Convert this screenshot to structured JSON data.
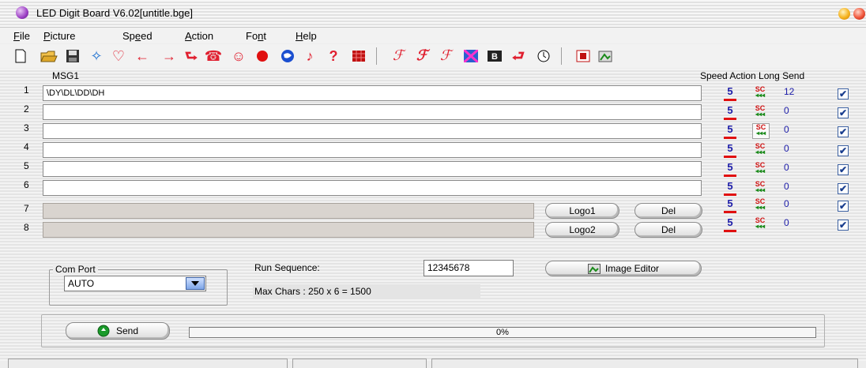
{
  "window": {
    "title": "LED Digit Board V6.02[untitle.bge]"
  },
  "menu": {
    "file": {
      "hot": "F",
      "rest": "ile"
    },
    "picture": {
      "hot": "P",
      "rest": "icture"
    },
    "speed": {
      "pre": "Sp",
      "hot": "e",
      "rest": "ed"
    },
    "action": {
      "hot": "A",
      "rest": "ction"
    },
    "font": {
      "pre": "Fo",
      "hot": "n",
      "rest": "t"
    },
    "help": {
      "hot": "H",
      "rest": "elp"
    }
  },
  "toolbar": {
    "icons": [
      "new-file-icon",
      "open-folder-icon",
      "save-disk-icon",
      "move-arrows-icon",
      "heart-icon",
      "arrow-left-icon",
      "arrow-right-icon",
      "enter-icon",
      "phone-icon",
      "smiley-icon",
      "red-circle-icon",
      "globe-icon",
      "music-note-icon",
      "question-icon",
      "grid-icon",
      "font-script-1-icon",
      "font-script-2-icon",
      "font-script-3-icon",
      "pattern-icon",
      "bold-icon",
      "reverse-icon",
      "clock-icon",
      "screen-icon",
      "image-editor-icon"
    ]
  },
  "messages": {
    "header": "MSG1",
    "column_headers": "Speed Action Long Send",
    "rows": [
      {
        "num": "1",
        "text": "\\DY\\DL\\DD\\DH",
        "speed": "5",
        "action": "SC",
        "long": "12",
        "send": "✔"
      },
      {
        "num": "2",
        "text": "",
        "speed": "5",
        "action": "SC",
        "long": "0",
        "send": "✔"
      },
      {
        "num": "3",
        "text": "",
        "speed": "5",
        "action": "SC",
        "long": "0",
        "send": "✔"
      },
      {
        "num": "4",
        "text": "",
        "speed": "5",
        "action": "SC",
        "long": "0",
        "send": "✔"
      },
      {
        "num": "5",
        "text": "",
        "speed": "5",
        "action": "SC",
        "long": "0",
        "send": "✔"
      },
      {
        "num": "6",
        "text": "",
        "speed": "5",
        "action": "SC",
        "long": "0",
        "send": "✔"
      },
      {
        "num": "7",
        "text": "",
        "speed": "5",
        "action": "SC",
        "long": "0",
        "send": "✔"
      },
      {
        "num": "8",
        "text": "",
        "speed": "5",
        "action": "SC",
        "long": "0",
        "send": "✔"
      }
    ],
    "action_arrows": "◂◂◂"
  },
  "logo": {
    "logo1_label": "Logo1",
    "logo2_label": "Logo2",
    "del_label": "Del"
  },
  "comport": {
    "title": "Com Port",
    "value": "AUTO"
  },
  "sequence": {
    "label": "Run Sequence:",
    "value": "12345678",
    "max_chars": "Max Chars : 250 x 6 = 1500"
  },
  "image_editor": {
    "label": "Image Editor"
  },
  "send": {
    "label": "Send",
    "progress_text": "0%",
    "progress": 0
  },
  "colors": {
    "speed_text": "#1b1ba8",
    "action_text": "#d01010",
    "action_arrows": "#1a8a1a",
    "check": "#1b3f8f"
  }
}
